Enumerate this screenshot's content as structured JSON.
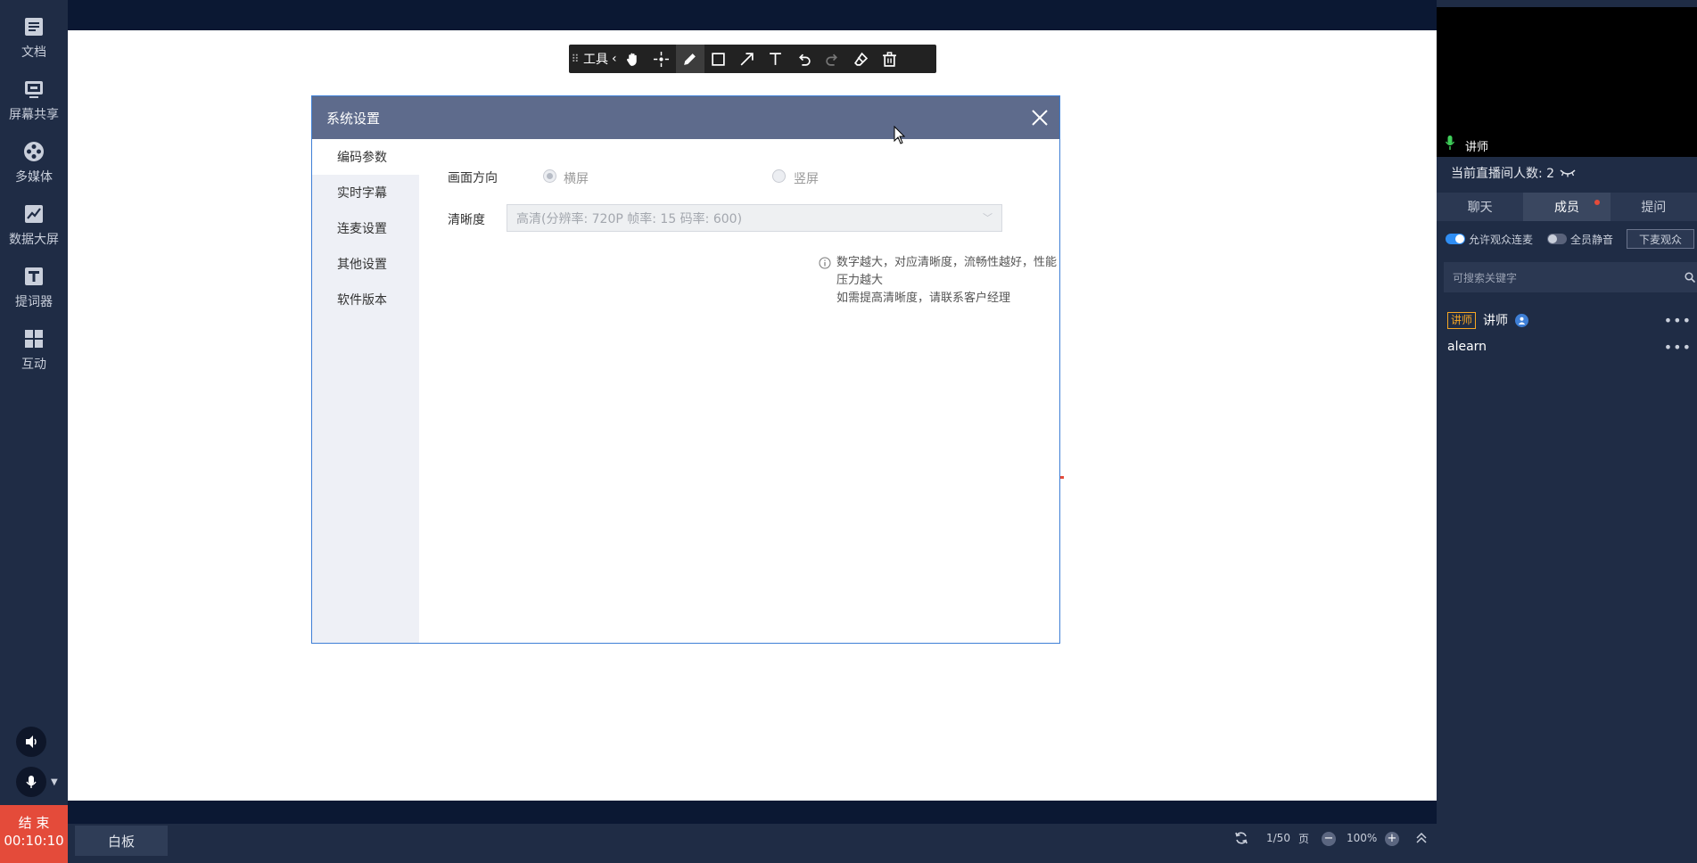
{
  "sidebar": {
    "items": [
      {
        "label": "文档",
        "icon": "document-icon"
      },
      {
        "label": "屏幕共享",
        "icon": "screen-share-icon"
      },
      {
        "label": "多媒体",
        "icon": "multimedia-icon"
      },
      {
        "label": "数据大屏",
        "icon": "data-screen-icon"
      },
      {
        "label": "提词器",
        "icon": "teleprompter-icon"
      },
      {
        "label": "互动",
        "icon": "interaction-icon"
      }
    ],
    "end_label": "结 束",
    "timer": "00:10:10"
  },
  "toolbar": {
    "tools_label": "工具"
  },
  "dialog": {
    "title": "系统设置",
    "nav": [
      "编码参数",
      "实时字幕",
      "连麦设置",
      "其他设置",
      "软件版本"
    ],
    "orientation_label": "画面方向",
    "landscape_label": "横屏",
    "portrait_label": "竖屏",
    "clarity_label": "清晰度",
    "clarity_value": "高清(分辨率: 720P  帧率: 15 码率: 600)",
    "hint_line1": "数字越大，对应清晰度，流畅性越好，性能压力越大",
    "hint_line2": "如需提高清晰度，请联系客户经理"
  },
  "bottombar": {
    "tab_label": "白板",
    "page": "1/50",
    "page_unit": "页",
    "zoom": "100%"
  },
  "rpanel": {
    "speaker_label": "讲师",
    "viewers_label": "当前直播间人数: 2",
    "tabs": [
      "聊天",
      "成员",
      "提问"
    ],
    "allow_mic_label": "允许观众连麦",
    "mute_all_label": "全员静音",
    "kick_label": "下麦观众",
    "search_placeholder": "可搜索关键字",
    "members": [
      {
        "badge": "讲师",
        "name": "讲师"
      },
      {
        "name": "alearn"
      }
    ]
  },
  "colors": {
    "accent": "#3e7fd6",
    "end_button": "#e44b3a",
    "dialog_header": "#5e6b8c",
    "badge": "#f5a623"
  }
}
